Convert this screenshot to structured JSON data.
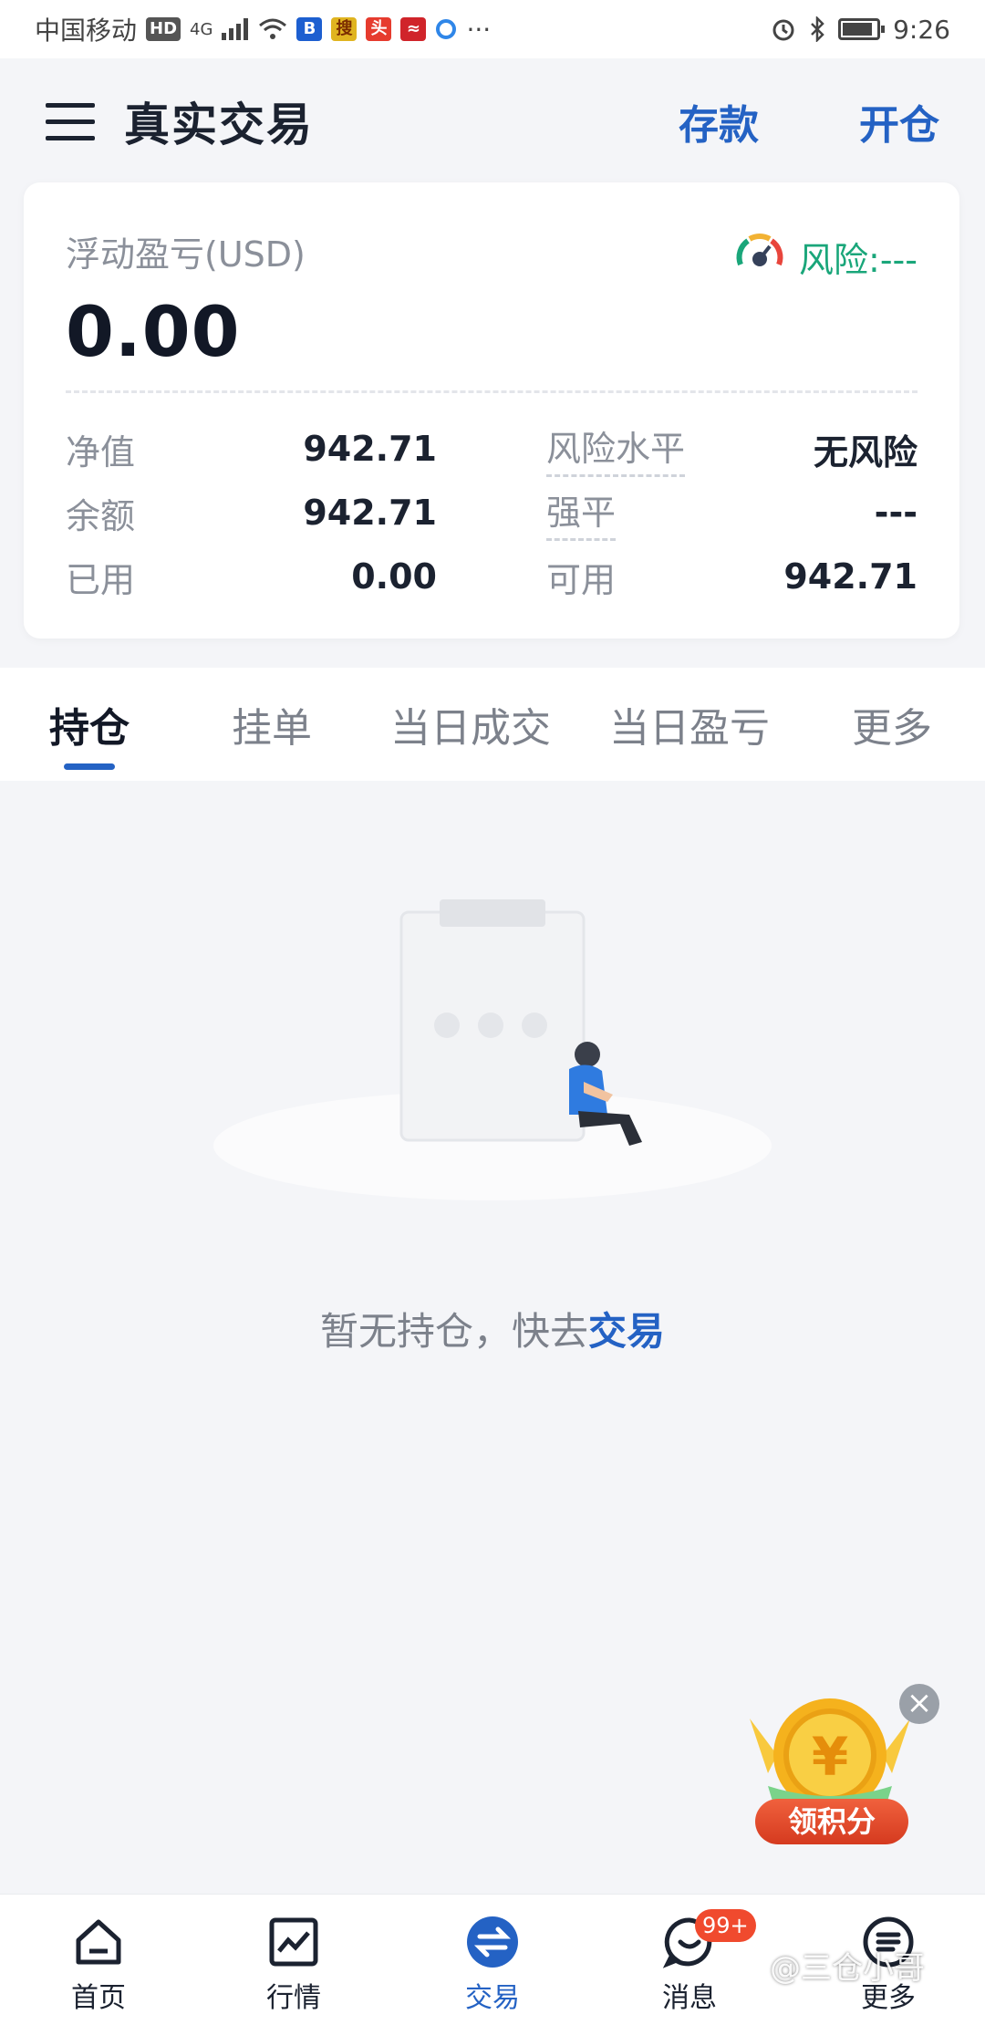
{
  "status_bar": {
    "carrier": "中国移动",
    "hd": "HD",
    "network": "4G",
    "time": "9:26",
    "more": "···"
  },
  "header": {
    "title": "真实交易",
    "deposit_label": "存款",
    "open_position_label": "开仓"
  },
  "account": {
    "pnl_label": "浮动盈亏(USD)",
    "pnl_value": "0.00",
    "risk_label": "风险:---",
    "left_stats": [
      {
        "label": "净值",
        "value": "942.71"
      },
      {
        "label": "余额",
        "value": "942.71"
      },
      {
        "label": "已用",
        "value": "0.00"
      }
    ],
    "right_stats": [
      {
        "label": "风险水平",
        "value": "无风险"
      },
      {
        "label": "强平",
        "value": "---"
      },
      {
        "label": "可用",
        "value": "942.71"
      }
    ]
  },
  "tabs": [
    {
      "label": "持仓",
      "active": true
    },
    {
      "label": "挂单",
      "active": false
    },
    {
      "label": "当日成交",
      "active": false
    },
    {
      "label": "当日盈亏",
      "active": false
    },
    {
      "label": "更多",
      "active": false
    }
  ],
  "empty_state": {
    "text": "暂无持仓，快去",
    "link": "交易"
  },
  "reward": {
    "label": "领积分",
    "close": "×"
  },
  "bottom_nav": [
    {
      "label": "首页",
      "icon": "home-icon"
    },
    {
      "label": "行情",
      "icon": "chart-icon"
    },
    {
      "label": "交易",
      "icon": "exchange-icon",
      "active": true
    },
    {
      "label": "消息",
      "icon": "message-icon",
      "badge": "99+"
    },
    {
      "label": "更多",
      "icon": "more-icon"
    }
  ],
  "watermark": "@三仓小哥",
  "colors": {
    "accent": "#2462c4",
    "risk_green": "#1aa67a",
    "badge_red": "#f04a2e",
    "background": "#f4f5f8"
  }
}
